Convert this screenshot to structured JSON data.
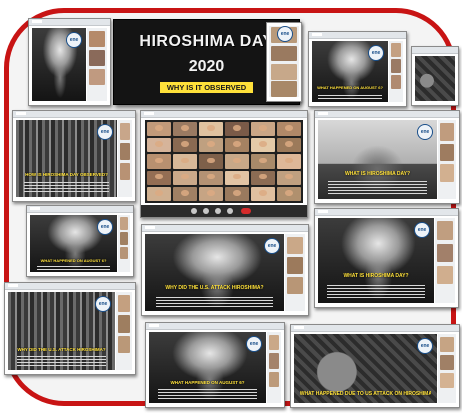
{
  "hero": {
    "title": "HIROSHIMA DAY",
    "year": "2020",
    "subtitle": "WHY IS IT OBSERVED",
    "logo_text": "ene"
  },
  "slides": {
    "s1": {
      "title": "",
      "logo": "ene"
    },
    "s2": {
      "title": "WHAT HAPPENED ON AUGUST 6?",
      "logo": "ene"
    },
    "s3": {
      "title": "",
      "logo": ""
    },
    "s4": {
      "title": "HOW IS HIROSHIMA DAY OBSERVED?",
      "logo": "ene"
    },
    "s5": {
      "title": "WHAT IS HIROSHIMA DAY?",
      "logo": "ene"
    },
    "s6": {
      "title": "WHAT HAPPENED ON AUGUST 6?",
      "logo": "ene"
    },
    "s7": {
      "title": "WHY DID THE U.S. ATTACK HIROSHIMA?",
      "logo": "ene"
    },
    "s8": {
      "title": "WHAT IS HIROSHIMA DAY?",
      "logo": "ene"
    },
    "s9": {
      "title": "WHY DID THE U.S. ATTACK HIROSHIMA?",
      "logo": "ene"
    },
    "s10": {
      "title": "WHAT HAPPENED ON AUGUST 6?",
      "logo": "ene"
    },
    "s11": {
      "title": "WHAT HAPPENED DUE TO US ATTACK ON HIROSHIMA?",
      "logo": "ene"
    }
  },
  "icons": {
    "toolbar": [
      "mic-icon",
      "camera-icon",
      "share-icon",
      "chat-icon",
      "end-call-icon"
    ]
  },
  "colors": {
    "border": "#c81414",
    "caption": "#ffe13a",
    "slide_bg": "#2a2a2a"
  }
}
